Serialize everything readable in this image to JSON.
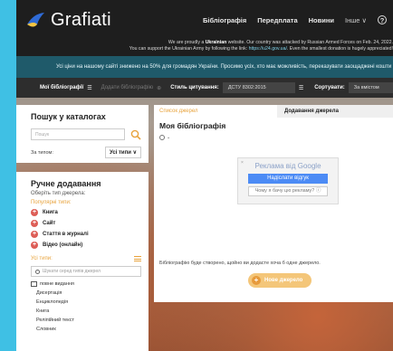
{
  "header": {
    "logo_text": "Grafiati",
    "nav": [
      "Бібліографія",
      "Передплата",
      "Новини"
    ],
    "more_label": "Інше ∨",
    "help_glyph": "?"
  },
  "ukraine_banner": {
    "line1_a": "We are proudly a ",
    "line1_bold": "Ukrainian",
    "line1_b": " website. Our country was attacked by Russian Armed Forces on Feb. 24, 2022.",
    "line2_a": "You can support the Ukrainian Army by following the link: ",
    "line2_link": "https://u24.gov.ua/",
    "line2_b": ". Even the smallest donation is hugely appreciated!"
  },
  "promo": "Усі ціни на нашому сайті знижено на 50% для громадян України. Просимо усіх, хто має можливість, переказувати заощаджені кошти",
  "toolbar": {
    "my_bib": "Мої бібліографії",
    "add_bib": "Додати бібліографію",
    "style_label": "Стиль цитування:",
    "style_value": "ДСТУ 8302:2015",
    "sort_label": "Сортувати:",
    "sort_value": "За вмістом"
  },
  "catalog_search": {
    "title": "Пошук у каталогах",
    "placeholder": "Пошук",
    "type_label": "За типом:",
    "type_value": "Усі типи ∨"
  },
  "manual_add": {
    "title": "Ручне додавання",
    "subtitle": "Оберіть тип джерела:",
    "popular_label": "Популярні типи:",
    "popular": [
      "Книга",
      "Сайт",
      "Стаття в журналі",
      "Відео (онлайн)"
    ],
    "all_label": "Усі типи:",
    "type_search_placeholder": "Шукати серед типів джерел",
    "full_view": "повне видання",
    "types": [
      "Дисертація",
      "Енциклопедія",
      "Книга",
      "Реліпійний текст",
      "Словник"
    ]
  },
  "main": {
    "tab_sources": "Список джерел",
    "tab_add": "Додавання джерела",
    "bib_title": "Моя бібліографія",
    "hint": "Бібліографію буде створено, щойно ви додасте хоча б одне джерело.",
    "new_source": "Нове джерело"
  },
  "ad": {
    "title": "Реклама від Google",
    "feedback": "Надіслати відгук",
    "why": "Чому я бачу цю рекламу? ⓘ",
    "close": "×"
  },
  "colors": {
    "accent": "#e8a33c",
    "plus_red": "#dd5d56",
    "google_blue": "#4c8bf5",
    "topbar": "#1e1e1e",
    "promo_bg": "#1f5a6a",
    "page_side": "#3fc0e4"
  }
}
